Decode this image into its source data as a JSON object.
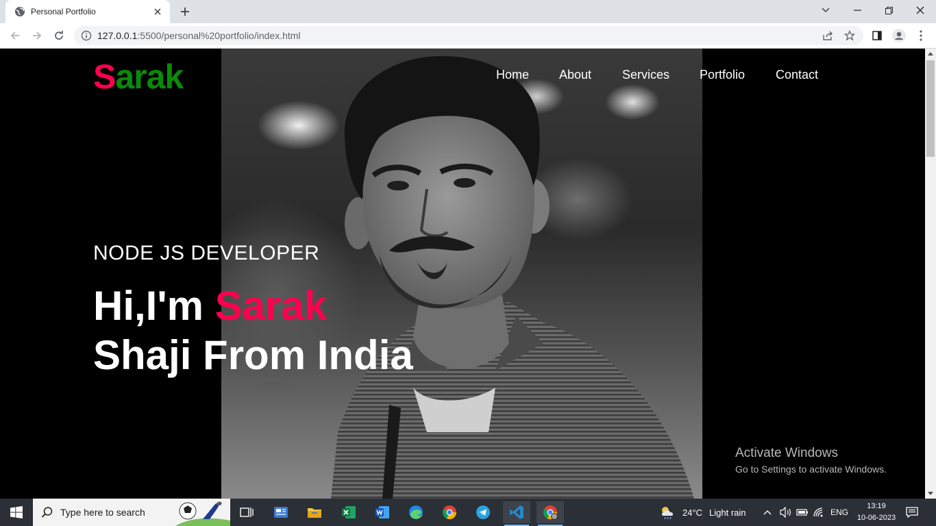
{
  "browser": {
    "tab_title": "Personal Portfolio",
    "url_host": "127.0.0.1",
    "url_rest": ":5500/personal%20portfolio/index.html"
  },
  "site": {
    "logo_first": "S",
    "logo_rest": "arak",
    "nav": [
      "Home",
      "About",
      "Services",
      "Portfolio",
      "Contact"
    ],
    "role": "NODE JS DEVELOPER",
    "headline_prefix": "Hi,I'm ",
    "headline_name": "Sarak",
    "headline_line2": "Shaji From India",
    "accent_color": "#ff004f",
    "logo_rest_color": "#0a8a0a"
  },
  "watermark": {
    "title": "Activate Windows",
    "subtitle": "Go to Settings to activate Windows."
  },
  "taskbar": {
    "search_placeholder": "Type here to search",
    "apps": [
      "task-view",
      "news",
      "file-explorer",
      "excel",
      "word",
      "edge",
      "chrome",
      "telegram",
      "vscode",
      "chrome-active"
    ],
    "weather_temp": "24°C",
    "weather_text": "Light rain",
    "language": "ENG",
    "time": "13:19",
    "date": "10-06-2023"
  }
}
